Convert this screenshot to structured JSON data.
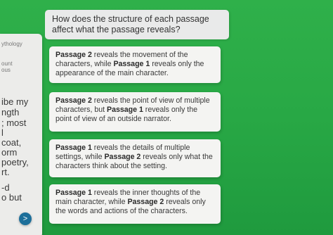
{
  "passage_fragment": {
    "lines": [
      "ythology",
      "ount",
      "ous",
      "ibe my",
      "ngth",
      "; most",
      "l",
      "coat,",
      "orm",
      "poetry,",
      "rt.",
      "-d",
      "o but"
    ]
  },
  "question": {
    "prompt": "How does the structure of each passage affect what the passage reveals?"
  },
  "choices": [
    {
      "p1": "Passage 2",
      "t1": " reveals the movement of the characters, while ",
      "p2": "Passage 1",
      "t2": " reveals only the appearance of the main character."
    },
    {
      "p1": "Passage 2",
      "t1": " reveals the point of view of multiple characters, but ",
      "p2": "Passage 1",
      "t2": " reveals only the point of view of an outside narrator."
    },
    {
      "p1": "Passage 1",
      "t1": " reveals the details of multiple settings, while ",
      "p2": "Passage 2",
      "t2": " reveals only what the characters think about the setting."
    },
    {
      "p1": "Passage 1",
      "t1": " reveals the inner thoughts of the main character, while ",
      "p2": "Passage 2",
      "t2": " reveals only the words and actions of the characters."
    }
  ],
  "nav": {
    "next_glyph": ">"
  }
}
